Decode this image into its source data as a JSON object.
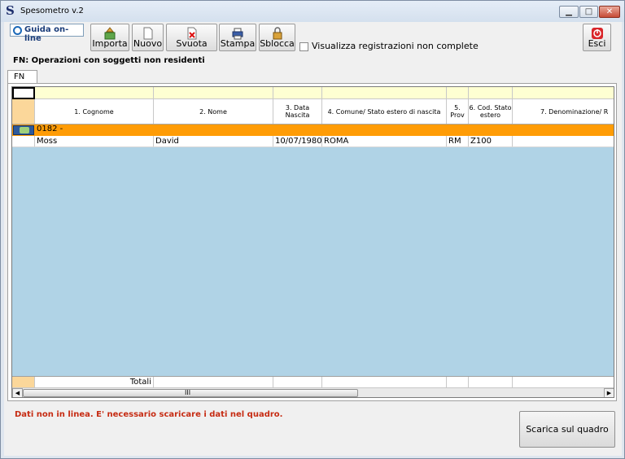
{
  "window": {
    "title": "Spesometro v.2",
    "app_icon_glyph": "S",
    "min_glyph": "▁",
    "max_glyph": "□",
    "close_glyph": "✕"
  },
  "toolbar": {
    "help_label": "Guida on-line",
    "buttons": {
      "importa": "Importa",
      "nuovo": "Nuovo",
      "svuota": "Svuota",
      "stampa": "Stampa",
      "sblocca": "Sblocca",
      "esci": "Esci"
    },
    "checkbox_label": "Visualizza registrazioni non complete",
    "checkbox_checked": false
  },
  "section_title": "FN: Operazioni con soggetti non residenti",
  "tabs": [
    {
      "label": "FN",
      "active": true
    }
  ],
  "grid": {
    "columns": [
      "1. Cognome",
      "2. Nome",
      "3. Data Nascita",
      "4. Comune/ Stato estero di nascita",
      "5. Prov",
      "6. Cod. Stato estero",
      "7. Denominazione/ R"
    ],
    "group_label": "0182 -",
    "rows": [
      [
        "Moss",
        "David",
        "10/07/1980",
        "ROMA",
        "RM",
        "Z100",
        ""
      ]
    ],
    "totals_label": "Totali",
    "scroll_grip": "III",
    "scroll_left": "◀",
    "scroll_right": "▶"
  },
  "status_message": "Dati non in linea. E' necessario scaricare i dati nel quadro.",
  "action_button": "Scarica sul quadro",
  "colors": {
    "filter_row": "#feffd2",
    "group_row": "#ff9c06",
    "grid_background": "#b0d3e6",
    "row_header": "#fbd79a",
    "status_text": "#c62b12"
  }
}
